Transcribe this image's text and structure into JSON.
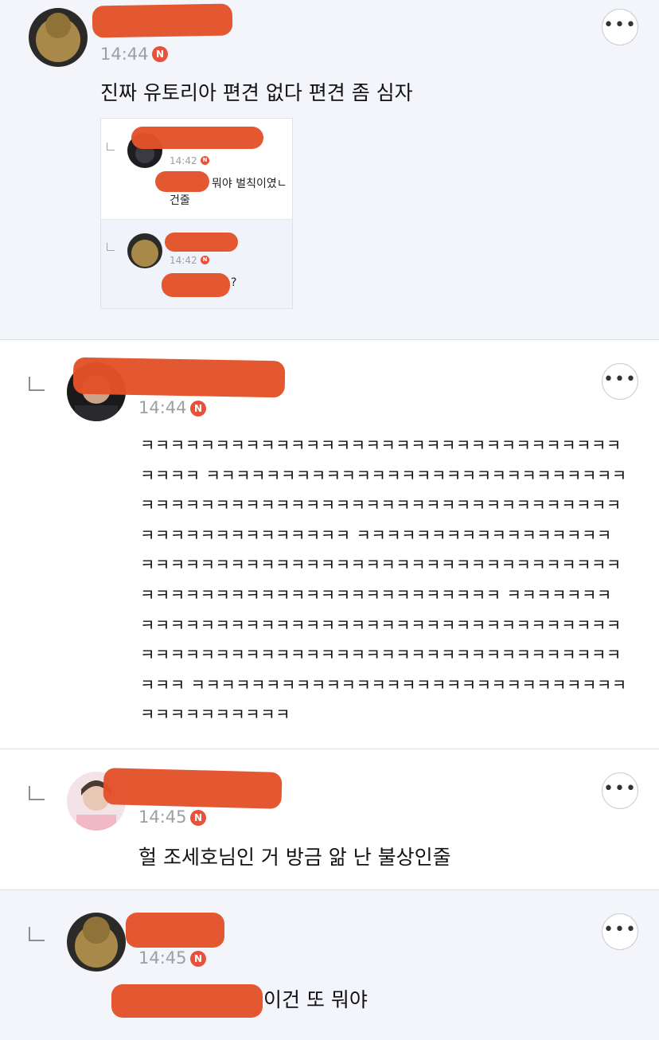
{
  "colors": {
    "redaction": "#e2522a",
    "new_badge": "#e8513a",
    "tinted_bg": "#f3f5fb",
    "time_text": "#9aa0a6"
  },
  "comments": [
    {
      "time": "14:44",
      "badge": "N",
      "text": "진짜 유토리아 편견 없다 편견 좀 심자",
      "more": "•••",
      "quoted": {
        "first": {
          "time": "14:42",
          "badge": "N",
          "text1": "뭐야 벌칙이였ㄴ",
          "text2": "건줄"
        },
        "second": {
          "time": "14:42",
          "badge": "N",
          "text": "?"
        }
      }
    },
    {
      "time": "14:44",
      "badge": "N",
      "more": "•••",
      "lines": [
        "ㅋㅋㅋㅋㅋㅋㅋㅋㅋㅋㅋㅋㅋㅋㅋㅋㅋㅋㅋㅋㅋㅋㅋㅋㅋㅋㅋㅋㅋㅋㅋㅋ",
        "ㅋㅋㅋㅋ ㅋㅋㅋㅋㅋㅋㅋㅋㅋㅋㅋㅋㅋㅋㅋㅋㅋㅋㅋㅋㅋㅋㅋㅋㅋㅋㅋㅋ",
        "ㅋㅋㅋㅋㅋㅋㅋㅋㅋㅋㅋㅋㅋㅋㅋㅋㅋㅋㅋㅋㅋㅋㅋㅋㅋㅋㅋㅋㅋㅋㅋㅋ",
        "ㅋㅋㅋㅋㅋㅋㅋㅋㅋㅋㅋㅋㅋㅋ ㅋㅋㅋㅋㅋㅋㅋㅋㅋㅋㅋㅋㅋㅋㅋㅋㅋ",
        "ㅋㅋㅋㅋㅋㅋㅋㅋㅋㅋㅋㅋㅋㅋㅋㅋㅋㅋㅋㅋㅋㅋㅋㅋㅋㅋㅋㅋㅋㅋㅋㅋ",
        "ㅋㅋㅋㅋㅋㅋㅋㅋㅋㅋㅋㅋㅋㅋㅋㅋㅋㅋㅋㅋㅋㅋㅋㅋ ㅋㅋㅋㅋㅋㅋㅋ",
        "ㅋㅋㅋㅋㅋㅋㅋㅋㅋㅋㅋㅋㅋㅋㅋㅋㅋㅋㅋㅋㅋㅋㅋㅋㅋㅋㅋㅋㅋㅋㅋㅋ",
        "ㅋㅋㅋㅋㅋㅋㅋㅋㅋㅋㅋㅋㅋㅋㅋㅋㅋㅋㅋㅋㅋㅋㅋㅋㅋㅋㅋㅋㅋㅋㅋㅋ",
        "ㅋㅋㅋ ㅋㅋㅋㅋㅋㅋㅋㅋㅋㅋㅋㅋㅋㅋㅋㅋㅋㅋㅋㅋㅋㅋㅋㅋㅋㅋㅋㅋㅋ",
        "ㅋㅋㅋㅋㅋㅋㅋㅋㅋㅋ"
      ]
    },
    {
      "time": "14:45",
      "badge": "N",
      "more": "•••",
      "text": "헐 조세호님인 거 방금 앎 난 불상인줄"
    },
    {
      "time": "14:45",
      "badge": "N",
      "more": "•••",
      "text": "이건 또 뭐야"
    }
  ]
}
